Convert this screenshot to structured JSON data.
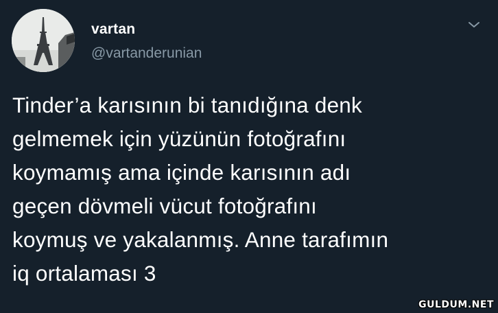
{
  "tweet": {
    "display_name": "vartan",
    "handle": "@vartanderunian",
    "text": "Tinder’a karısının bi tanıdığına denk\ngelmemek için yüzünün fotoğrafını\nkoymamış ama içinde karısının adı\ngeçen dövmeli vücut fotoğrafını\nkoymuş ve yakalanmış. Anne tarafımın\niq ortalaması 3"
  },
  "watermark": "GULDUM.NET",
  "icons": {
    "menu": "chevron-down-icon",
    "avatar": "eiffel-tower-photo"
  },
  "colors": {
    "background": "#15202b",
    "primary_text": "#ffffff",
    "secondary_text": "#8899a6"
  }
}
